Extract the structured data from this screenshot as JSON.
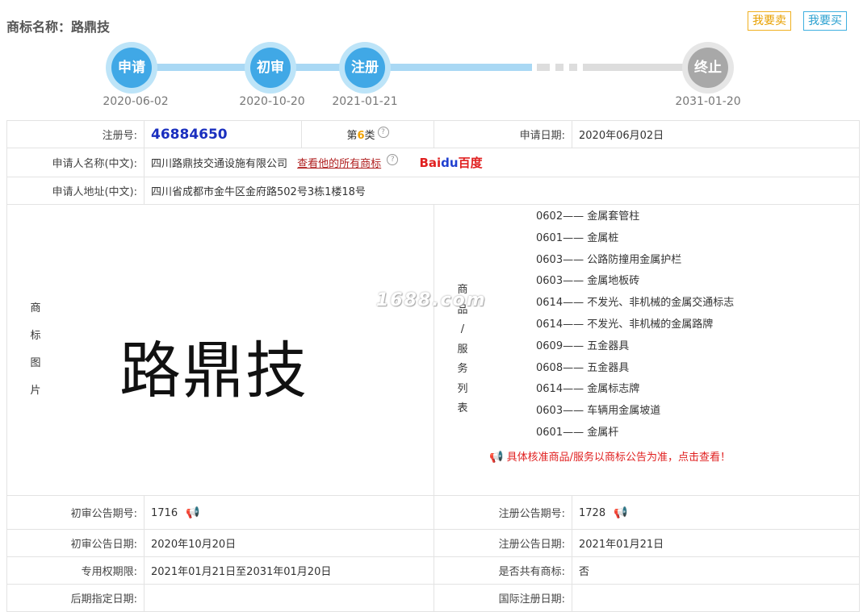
{
  "header": {
    "title": "商标名称：路鼎技",
    "sell_label": "我要卖",
    "buy_label": "我要买"
  },
  "timeline": [
    {
      "label": "申请",
      "date": "2020-06-02",
      "state": "done"
    },
    {
      "label": "初审",
      "date": "2020-10-20",
      "state": "done"
    },
    {
      "label": "注册",
      "date": "2021-01-21",
      "state": "done"
    },
    {
      "label": "终止",
      "date": "2031-01-20",
      "state": "future"
    }
  ],
  "info": {
    "reg_no_label": "注册号:",
    "reg_no": "46884650",
    "class_prefix": "第",
    "class_num": "6",
    "class_suffix": "类",
    "apply_date_label": "申请日期:",
    "apply_date": "2020年06月02日",
    "applicant_label": "申请人名称(中文):",
    "applicant": "四川路鼎技交通设施有限公司",
    "all_marks_link": "查看他的所有商标",
    "baidu_text": "Bai",
    "baidu_paw": "du",
    "baidu_cn": "百度",
    "address_label": "申请人地址(中文):",
    "address": "四川省成都市金牛区金府路502号3栋1楼18号"
  },
  "image_section": {
    "label_chars": [
      "商",
      "标",
      "图",
      "片"
    ],
    "mark_text": "路鼎技",
    "watermark": "1688.com"
  },
  "goods_section": {
    "label_chars": [
      "商",
      "品",
      "/",
      "服",
      "务",
      "列",
      "表"
    ],
    "items": [
      "0602—— 金属套管柱",
      "0601—— 金属桩",
      "0603—— 公路防撞用金属护栏",
      "0603—— 金属地板砖",
      "0614—— 不发光、非机械的金属交通标志",
      "0614—— 不发光、非机械的金属路牌",
      "0609—— 五金器具",
      "0608—— 五金器具",
      "0614—— 金属标志牌",
      "0603—— 车辆用金属坡道",
      "0601—— 金属杆"
    ],
    "notice": "具体核准商品/服务以商标公告为准，点击查看！"
  },
  "pub": {
    "prelim_no_label": "初审公告期号:",
    "prelim_no": "1716",
    "reg_pub_no_label": "注册公告期号:",
    "reg_pub_no": "1728",
    "prelim_date_label": "初审公告日期:",
    "prelim_date": "2020年10月20日",
    "reg_pub_date_label": "注册公告日期:",
    "reg_pub_date": "2021年01月21日",
    "exclusive_label": "专用权期限:",
    "exclusive": "2021年01月21日至2031年01月20日",
    "shared_label": "是否共有商标:",
    "shared": "否",
    "later_label": "后期指定日期:",
    "intl_label": "国际注册日期:"
  }
}
